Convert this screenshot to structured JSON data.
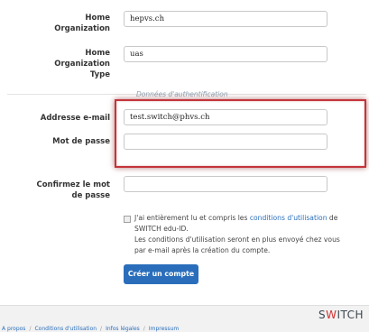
{
  "fields": {
    "home_org": {
      "label_l1": "Home",
      "label_l2": "Organization",
      "value": "hepvs.ch"
    },
    "home_org_type": {
      "label_l1": "Home",
      "label_l2": "Organization",
      "label_l3": "Type",
      "value": "uas"
    },
    "section_title": "Données d'authentification",
    "email": {
      "label": "Addresse e-mail",
      "value": "test.switch@phvs.ch"
    },
    "password": {
      "label": "Mot de passe",
      "value": ""
    },
    "confirm": {
      "label_l1": "Confirmez le mot",
      "label_l2": "de passe",
      "value": ""
    }
  },
  "terms": {
    "prefix": "J'ai entièrement lu et compris les ",
    "link": "conditions d'utilisation",
    "suffix": " de SWITCH edu-ID.",
    "note": "Les conditions d'utilisation seront en plus envoyé chez vous par e-mail après la création du compte."
  },
  "submit_label": "Créer un compte",
  "logo": {
    "pre": "S",
    "mark": "W",
    "post": "ITCH"
  },
  "footer": [
    "A propos",
    "Conditions d'utilisation",
    "Infos légales",
    "Impressum"
  ],
  "colors": {
    "accent": "#2a6ebb",
    "highlight": "#c4343b"
  }
}
